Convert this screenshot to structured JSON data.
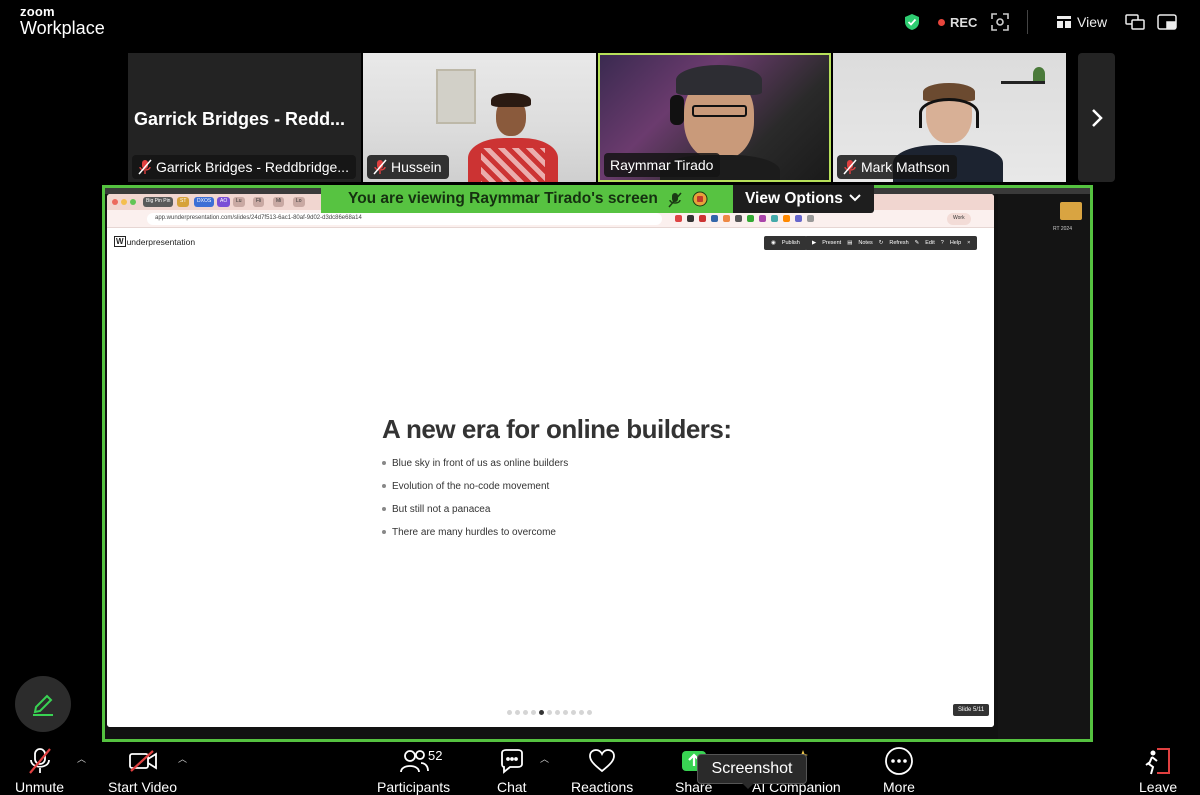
{
  "app": {
    "brand_top": "zoom",
    "brand_bottom": "Workplace"
  },
  "topbar": {
    "rec_label": "REC",
    "view_label": "View",
    "icons": [
      "shield-check-icon",
      "expand-icon",
      "view-grid-icon",
      "pip-icon",
      "minimize-icon"
    ]
  },
  "participants": [
    {
      "name": "Garrick Bridges - Reddbridge...",
      "big_name": "Garrick Bridges - Redd...",
      "muted": true,
      "video": false
    },
    {
      "name": "Hussein",
      "muted": true,
      "video": true
    },
    {
      "name": "Raymmar Tirado",
      "muted": false,
      "video": true,
      "speaking": true
    },
    {
      "name": "Mark Mathson",
      "muted": true,
      "video": true
    }
  ],
  "share_banner": {
    "viewing_text": "You are viewing  Raymmar Tirado's screen",
    "view_options_label": "View Options"
  },
  "browser": {
    "url": "app.wunderpresentation.com/slides/24d7f513-6ac1-80af-9d02-d3dc86e68a14",
    "tabs": [
      "Big Pin Pin",
      "ST",
      "DXOS",
      "AO",
      "Lu",
      "Fli",
      "Mi",
      "Lo"
    ],
    "profile_label": "Work"
  },
  "app_page": {
    "logo_box": "W",
    "logo_rest": "underpresentation",
    "toolbar": {
      "publish": "Publish",
      "present": "Present",
      "notes": "Notes",
      "refresh": "Refresh",
      "edit": "Edit",
      "help": "Help",
      "close": "×"
    }
  },
  "slide": {
    "title": "A new era for online builders:",
    "bullets": [
      "Blue sky in front of us as online builders",
      "Evolution of the no-code movement",
      "But still not a panacea",
      "There are many hurdles to overcome"
    ],
    "current": 5,
    "total": 11,
    "counter_label": "Slide 5/11"
  },
  "desktop": {
    "folder_label": "RT 2024"
  },
  "toolbar": {
    "unmute": "Unmute",
    "start_video": "Start Video",
    "participants": "Participants",
    "participants_count": "52",
    "chat": "Chat",
    "reactions": "Reactions",
    "share": "Share",
    "ai_companion": "AI Companion",
    "more": "More",
    "leave": "Leave"
  },
  "tooltip": {
    "text": "Screenshot"
  },
  "colors": {
    "share_border": "#55c240",
    "speaker_border": "#b7e05a",
    "rec": "#e8453c",
    "shield": "#2ecc71"
  }
}
